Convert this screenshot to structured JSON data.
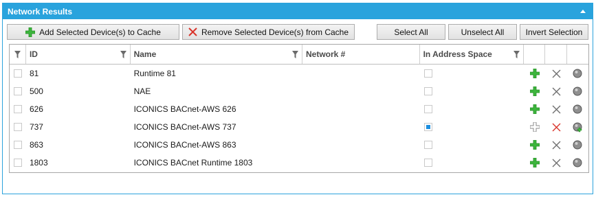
{
  "panel": {
    "title": "Network Results"
  },
  "toolbar": {
    "add_label": "Add Selected Device(s) to Cache",
    "remove_label": "Remove Selected Device(s) from Cache",
    "select_all_label": "Select All",
    "unselect_all_label": "Unselect All",
    "invert_label": "Invert Selection"
  },
  "grid": {
    "columns": [
      "ID",
      "Name",
      "Network #",
      "In Address Space"
    ],
    "rows": [
      {
        "id": "81",
        "name": "Runtime 81",
        "network": "",
        "in_address_space": false
      },
      {
        "id": "500",
        "name": "NAE",
        "network": "",
        "in_address_space": false
      },
      {
        "id": "626",
        "name": "ICONICS BACnet-AWS 626",
        "network": "",
        "in_address_space": false
      },
      {
        "id": "737",
        "name": "ICONICS BACnet-AWS 737",
        "network": "",
        "in_address_space": true
      },
      {
        "id": "863",
        "name": "ICONICS BACnet-AWS 863",
        "network": "",
        "in_address_space": false
      },
      {
        "id": "1803",
        "name": "ICONICS BACnet Runtime 1803",
        "network": "",
        "in_address_space": false
      }
    ]
  },
  "colors": {
    "accent": "#29a3dd",
    "add_green": "#3db53d",
    "remove_red": "#d9342b"
  },
  "icons": {
    "add": "plus-icon",
    "remove": "x-icon",
    "details": "globe-icon",
    "filter": "funnel-icon"
  }
}
